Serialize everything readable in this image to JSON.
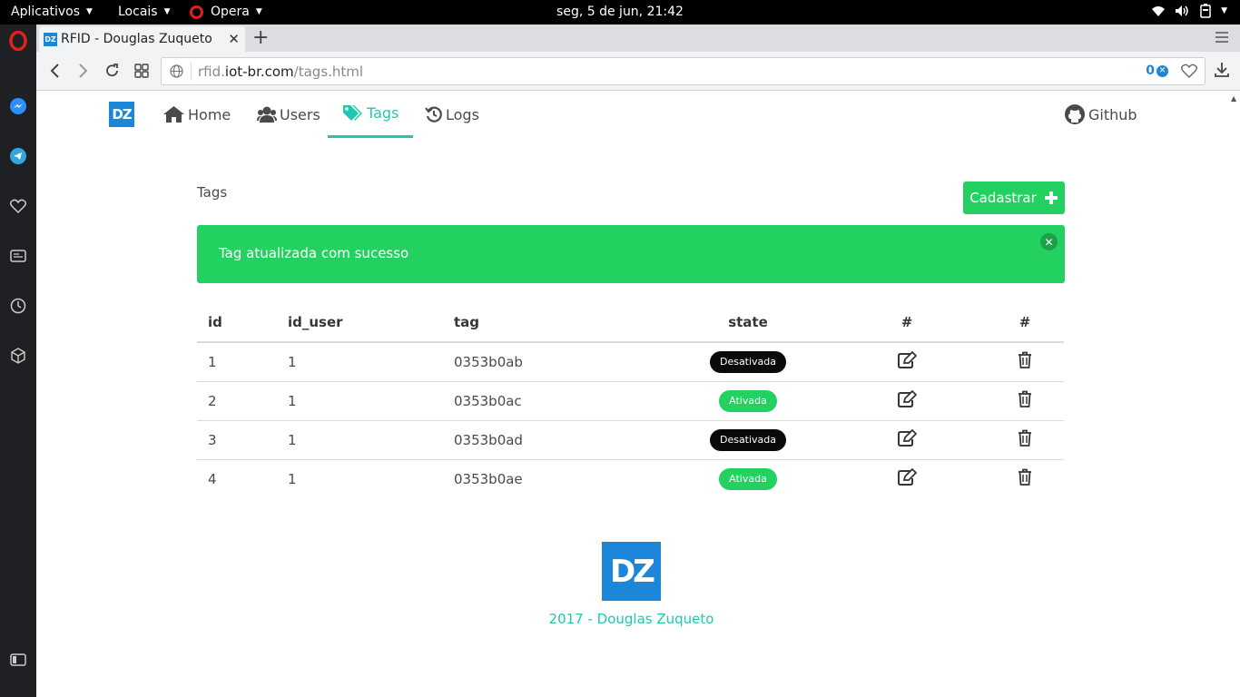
{
  "system_bar": {
    "apps_menu": "Aplicativos",
    "places_menu": "Locais",
    "browser_menu": "Opera",
    "clock": "seg,  5 de jun, 21:42"
  },
  "browser": {
    "tab_title": "RFID - Douglas Zuqueto",
    "tab_favicon": "DZ",
    "url_prefix": "rfid.",
    "url_host": "iot-br.com",
    "url_path": "/tags.html",
    "blocker_count": "0"
  },
  "site_nav": {
    "logo": "DZ",
    "items": [
      {
        "label": "Home",
        "icon": "home-icon"
      },
      {
        "label": "Users",
        "icon": "users-icon"
      },
      {
        "label": "Tags",
        "icon": "tags-icon",
        "active": true
      },
      {
        "label": "Logs",
        "icon": "history-icon"
      }
    ],
    "github": "Github"
  },
  "main": {
    "heading": "Tags",
    "add_button": "Cadastrar",
    "notification": "Tag atualizada com sucesso"
  },
  "table": {
    "headers": [
      "id",
      "id_user",
      "tag",
      "state",
      "#",
      "#"
    ],
    "rows": [
      {
        "id": "1",
        "id_user": "1",
        "tag": "0353b0ab",
        "state": "Desativada",
        "state_color": "#0a0a0a"
      },
      {
        "id": "2",
        "id_user": "1",
        "tag": "0353b0ac",
        "state": "Ativada",
        "state_color": "#23d160"
      },
      {
        "id": "3",
        "id_user": "1",
        "tag": "0353b0ad",
        "state": "Desativada",
        "state_color": "#0a0a0a"
      },
      {
        "id": "4",
        "id_user": "1",
        "tag": "0353b0ae",
        "state": "Ativada",
        "state_color": "#23d160"
      }
    ]
  },
  "footer": {
    "logo": "DZ",
    "text": "2017 - Douglas Zuqueto"
  },
  "colors": {
    "primary": "#1fc8b0",
    "success": "#23d160",
    "brand_blue": "#1c87d8",
    "dark": "#0a0a0a"
  }
}
